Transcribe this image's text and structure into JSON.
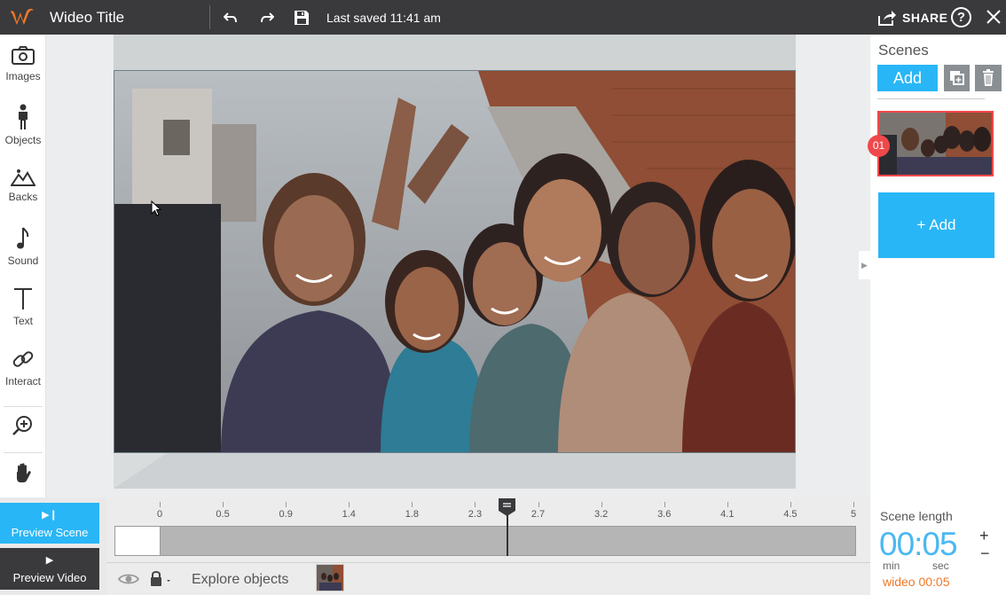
{
  "header": {
    "title": "Wideo Title",
    "saved_status": "Last saved 11:41 am",
    "share_label": "SHARE",
    "help_label": "?"
  },
  "left_tools": [
    {
      "label": "Images",
      "icon": "camera-icon"
    },
    {
      "label": "Objects",
      "icon": "person-icon"
    },
    {
      "label": "Backs",
      "icon": "mountain-icon"
    },
    {
      "label": "Sound",
      "icon": "music-note-icon"
    },
    {
      "label": "Text",
      "icon": "text-icon"
    },
    {
      "label": "Interact",
      "icon": "link-icon"
    }
  ],
  "scenes": {
    "title": "Scenes",
    "add_label": "Add",
    "items": [
      {
        "number": "01"
      }
    ],
    "add_big_label": "+ Add"
  },
  "timeline": {
    "ticks": [
      "0",
      "0.5",
      "0.9",
      "1.4",
      "1.8",
      "2.3",
      "2.7",
      "3.2",
      "3.6",
      "4.1",
      "4.5",
      "5"
    ],
    "playhead_seconds": 2.5,
    "explore_label": "Explore objects"
  },
  "preview": {
    "scene_label": "Preview Scene",
    "video_label": "Preview Video"
  },
  "scene_length": {
    "title": "Scene length",
    "value": "00:05",
    "min_label": "min",
    "sec_label": "sec",
    "plus": "+",
    "minus": "−",
    "total": "wideo 00:05"
  },
  "colors": {
    "accent": "#29b6f6",
    "brand": "#f07828",
    "selected": "#f0494b",
    "topbar": "#3a3a3c"
  }
}
